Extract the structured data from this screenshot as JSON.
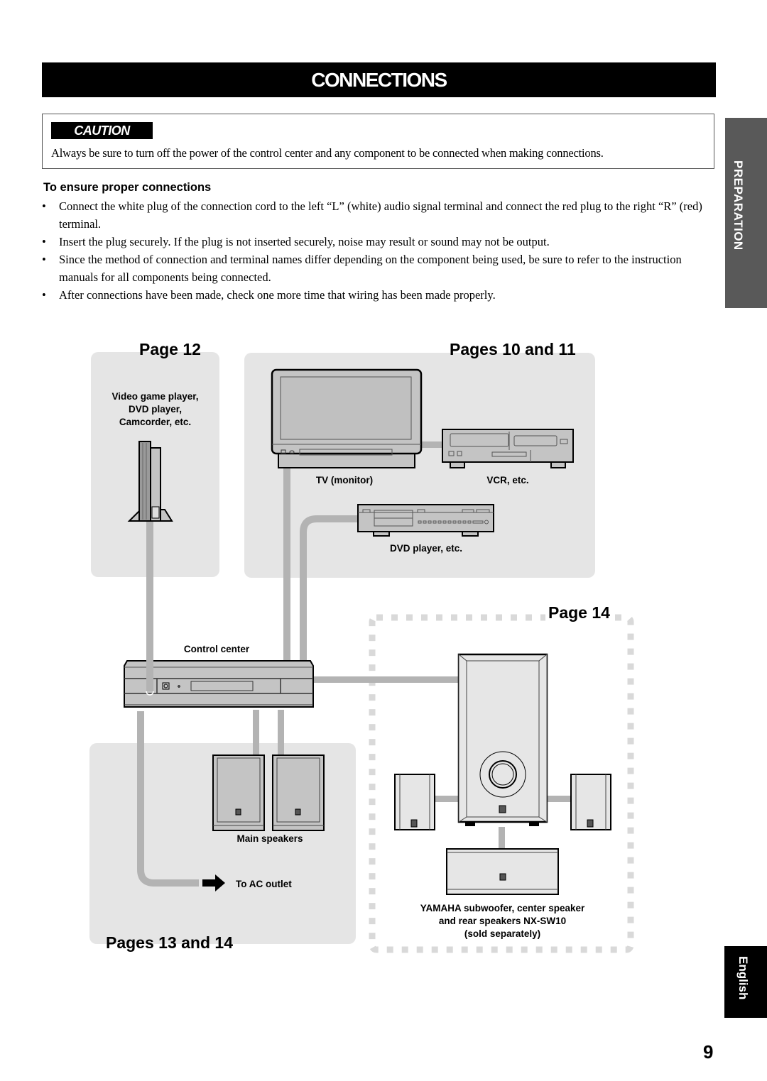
{
  "header": {
    "title": "CONNECTIONS"
  },
  "caution": {
    "label": "CAUTION",
    "text": "Always be sure to turn off the power of the control center and any component to be connected when making connections."
  },
  "side_tabs": {
    "section": "PREPARATION",
    "language": "English"
  },
  "proper_connections": {
    "heading": "To ensure proper connections",
    "bullet_glyph": "•",
    "items": [
      "Connect the white plug of the connection cord to the left “L” (white) audio signal terminal and connect the red plug to the right “R” (red) terminal.",
      "Insert the plug securely. If the plug is not inserted securely, noise may result or sound may not be output.",
      "Since the method of connection and terminal names differ depending on the component being used, be sure to refer to the instruction manuals for all components being connected.",
      "After connections have been made, check one more time that wiring has been made properly."
    ]
  },
  "diagram": {
    "page_refs": {
      "game_player": "Page 12",
      "video": "Pages 10 and 11",
      "subwoofer": "Page 14",
      "speakers": "Pages 13 and 14"
    },
    "labels": {
      "game_player_line1": "Video game player,",
      "game_player_line2": "DVD player,",
      "game_player_line3": "Camcorder, etc.",
      "tv": "TV (monitor)",
      "vcr": "VCR, etc.",
      "dvd": "DVD player, etc.",
      "control_center": "Control center",
      "main_speakers": "Main speakers",
      "ac_outlet": "To AC outlet",
      "yamaha_line1": "YAMAHA subwoofer, center speaker",
      "yamaha_line2": "and rear speakers NX-SW10",
      "yamaha_line3": "(sold separately)"
    },
    "colors": {
      "panel": "#e5e5e5",
      "cable": "#b3b3b3",
      "device_fill": "#c4c4c4",
      "speaker_fill": "#e6e6e6",
      "dashed_border": "#d9d9d9"
    }
  },
  "footer": {
    "page_number": "9"
  }
}
